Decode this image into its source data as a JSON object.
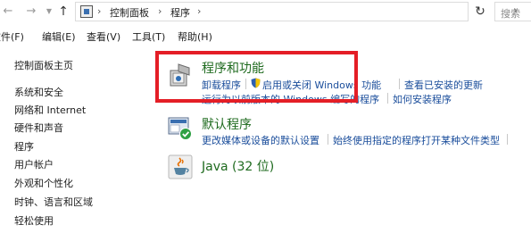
{
  "address_bar": {
    "crumbs": [
      "控制面板",
      "程序"
    ],
    "search_placeholder": "搜索"
  },
  "menu": [
    "文件(F)",
    "编辑(E)",
    "查看(V)",
    "工具(T)",
    "帮助(H)"
  ],
  "sidebar": {
    "items": [
      "控制面板主页",
      "系统和安全",
      "网络和 Internet",
      "硬件和声音",
      "程序",
      "用户帐户",
      "外观和个性化",
      "时钟、语言和区域",
      "轻松使用"
    ],
    "current": "程序"
  },
  "categories": [
    {
      "title": "程序和功能",
      "links_row1": [
        "卸载程序",
        "启用或关闭 Windows 功能",
        "查看已安装的更新"
      ],
      "links_row2": [
        "运行为以前版本的 Windows 编写的程序",
        "如何安装程序"
      ]
    },
    {
      "title": "默认程序",
      "links_row1": [
        "更改媒体或设备的默认设置",
        "始终使用指定的程序打开某种文件类型"
      ]
    },
    {
      "title": "Java (32 位)"
    }
  ],
  "colors": {
    "link": "#1a4d9b",
    "category_title": "#1e6a1e",
    "highlight": "#e41e26"
  }
}
